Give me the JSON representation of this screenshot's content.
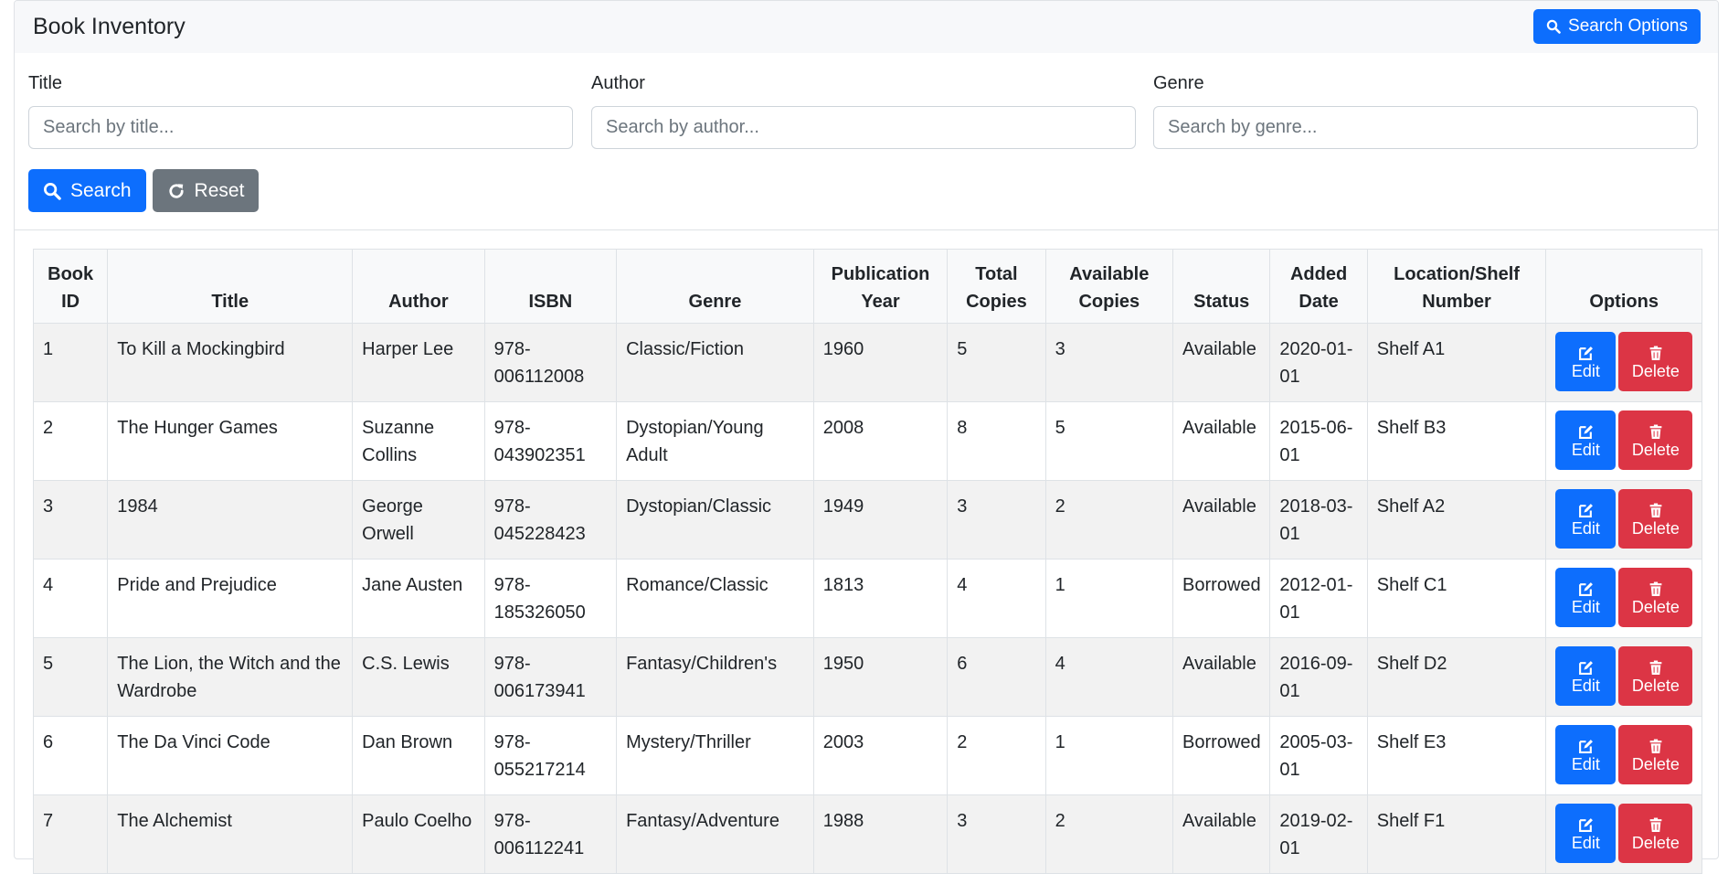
{
  "header": {
    "title": "Book Inventory",
    "search_options_label": "Search Options"
  },
  "filters": {
    "title": {
      "label": "Title",
      "placeholder": "Search by title..."
    },
    "author": {
      "label": "Author",
      "placeholder": "Search by author..."
    },
    "genre": {
      "label": "Genre",
      "placeholder": "Search by genre..."
    },
    "search_label": "Search",
    "reset_label": "Reset"
  },
  "table": {
    "columns": [
      "Book ID",
      "Title",
      "Author",
      "ISBN",
      "Genre",
      "Publication Year",
      "Total Copies",
      "Available Copies",
      "Status",
      "Added Date",
      "Location/Shelf Number",
      "Options"
    ],
    "edit_label": "Edit",
    "delete_label": "Delete",
    "rows": [
      [
        "1",
        "To Kill a Mockingbird",
        "Harper Lee",
        "978-006112008",
        "Classic/Fiction",
        "1960",
        "5",
        "3",
        "Available",
        "2020-01-01",
        "Shelf A1"
      ],
      [
        "2",
        "The Hunger Games",
        "Suzanne Collins",
        "978-043902351",
        "Dystopian/Young Adult",
        "2008",
        "8",
        "5",
        "Available",
        "2015-06-01",
        "Shelf B3"
      ],
      [
        "3",
        "1984",
        "George Orwell",
        "978-045228423",
        "Dystopian/Classic",
        "1949",
        "3",
        "2",
        "Available",
        "2018-03-01",
        "Shelf A2"
      ],
      [
        "4",
        "Pride and Prejudice",
        "Jane Austen",
        "978-185326050",
        "Romance/Classic",
        "1813",
        "4",
        "1",
        "Borrowed",
        "2012-01-01",
        "Shelf C1"
      ],
      [
        "5",
        "The Lion, the Witch and the Wardrobe",
        "C.S. Lewis",
        "978-006173941",
        "Fantasy/Children's",
        "1950",
        "6",
        "4",
        "Available",
        "2016-09-01",
        "Shelf D2"
      ],
      [
        "6",
        "The Da Vinci Code",
        "Dan Brown",
        "978-055217214",
        "Mystery/Thriller",
        "2003",
        "2",
        "1",
        "Borrowed",
        "2005-03-01",
        "Shelf E3"
      ],
      [
        "7",
        "The Alchemist",
        "Paulo Coelho",
        "978-006112241",
        "Fantasy/Adventure",
        "1988",
        "3",
        "2",
        "Available",
        "2019-02-01",
        "Shelf F1"
      ]
    ]
  },
  "colors": {
    "primary": "#0d6efd",
    "secondary": "#6c757d",
    "danger": "#dc3545"
  }
}
